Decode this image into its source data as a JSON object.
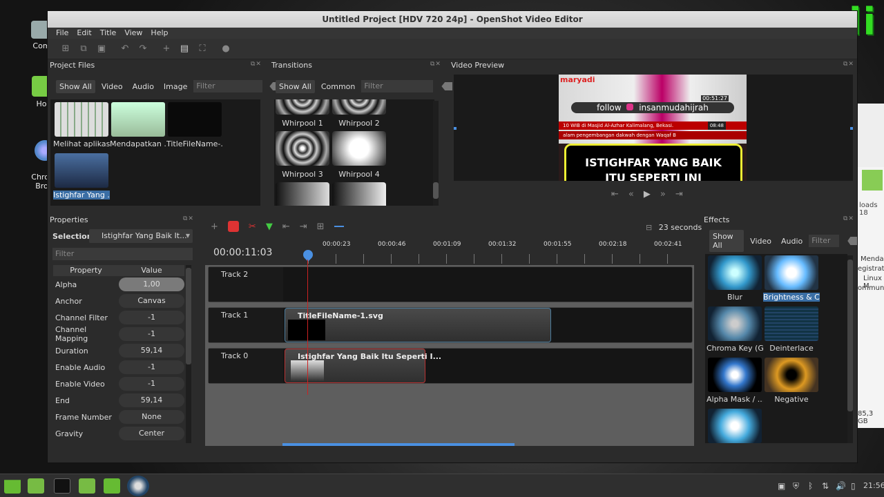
{
  "watermark": "maryadi",
  "desktop": {
    "icons": [
      {
        "label": "Com"
      },
      {
        "label": "Ho"
      },
      {
        "label": "Chromi\nBrow"
      }
    ],
    "bg_window_text": [
      "Mendap",
      "egistratio",
      "Linux M",
      "ommuni",
      "loads 18",
      "85,3 GB"
    ]
  },
  "window": {
    "title": "Untitled Project [HDV 720 24p] - OpenShot Video Editor",
    "menu": [
      "File",
      "Edit",
      "Title",
      "View",
      "Help"
    ]
  },
  "project_files": {
    "title": "Project Files",
    "filters": [
      "Show All",
      "Video",
      "Audio",
      "Image"
    ],
    "filter_placeholder": "Filter",
    "items": [
      "Melihat aplikas...",
      "Mendapatkan ...",
      "TitleFileName-...",
      "Istighfar Yang ..."
    ]
  },
  "transitions": {
    "title": "Transitions",
    "filters": [
      "Show All",
      "Common"
    ],
    "filter_placeholder": "Filter",
    "items": [
      "Whirpool 1",
      "Whirpool 2",
      "Whirpool 3",
      "Whirpool 4"
    ]
  },
  "video_preview": {
    "title": "Video Preview",
    "overlay_logo": "maryadi",
    "follow_text": "follow",
    "handle": "insanmudahijrah",
    "time_small": "00:51:27",
    "ticker1": "10 WIB di Masjid Al-Azhar Kalimalang, Bekasi.",
    "ticker_time": "08:48",
    "ticker2": "alam pengembangan dakwah dengan Waqaf B",
    "banner_line1": "ISTIGHFAR YANG BAIK",
    "banner_line2": "ITU SEPERTI INI"
  },
  "properties": {
    "title": "Properties",
    "selection_label": "Selection:",
    "selection_value": "Istighfar Yang Baik It...",
    "filter_placeholder": "Filter",
    "col_property": "Property",
    "col_value": "Value",
    "rows": [
      {
        "name": "Alpha",
        "value": "1,00"
      },
      {
        "name": "Anchor",
        "value": "Canvas"
      },
      {
        "name": "Channel Filter",
        "value": "-1"
      },
      {
        "name": "Channel Mapping",
        "value": "-1"
      },
      {
        "name": "Duration",
        "value": "59,14"
      },
      {
        "name": "Enable Audio",
        "value": "-1"
      },
      {
        "name": "Enable Video",
        "value": "-1"
      },
      {
        "name": "End",
        "value": "59,14"
      },
      {
        "name": "Frame Number",
        "value": "None"
      },
      {
        "name": "Gravity",
        "value": "Center"
      }
    ]
  },
  "timeline": {
    "zoom_label": "23 seconds",
    "current_time": "00:00:11:03",
    "ruler": [
      "00:00:23",
      "00:00:46",
      "00:01:09",
      "00:01:32",
      "00:01:55",
      "00:02:18",
      "00:02:41"
    ],
    "tracks": [
      {
        "name": "Track 2"
      },
      {
        "name": "Track 1",
        "clip": "TitleFileName-1.svg"
      },
      {
        "name": "Track 0",
        "clip": "Istighfar Yang Baik Itu Seperti I..."
      }
    ]
  },
  "effects": {
    "title": "Effects",
    "filters": [
      "Show All",
      "Video",
      "Audio"
    ],
    "filter_placeholder": "Filter",
    "items": [
      "Blur",
      "Brightness & C...",
      "Chroma Key (G...",
      "Deinterlace",
      "Alpha Mask / ...",
      "Negative"
    ]
  },
  "taskbar": {
    "clock": "21:56"
  },
  "colors": {
    "accent": "#3a6ea5",
    "playhead": "#cc2222",
    "watermark": "#33dd22"
  }
}
